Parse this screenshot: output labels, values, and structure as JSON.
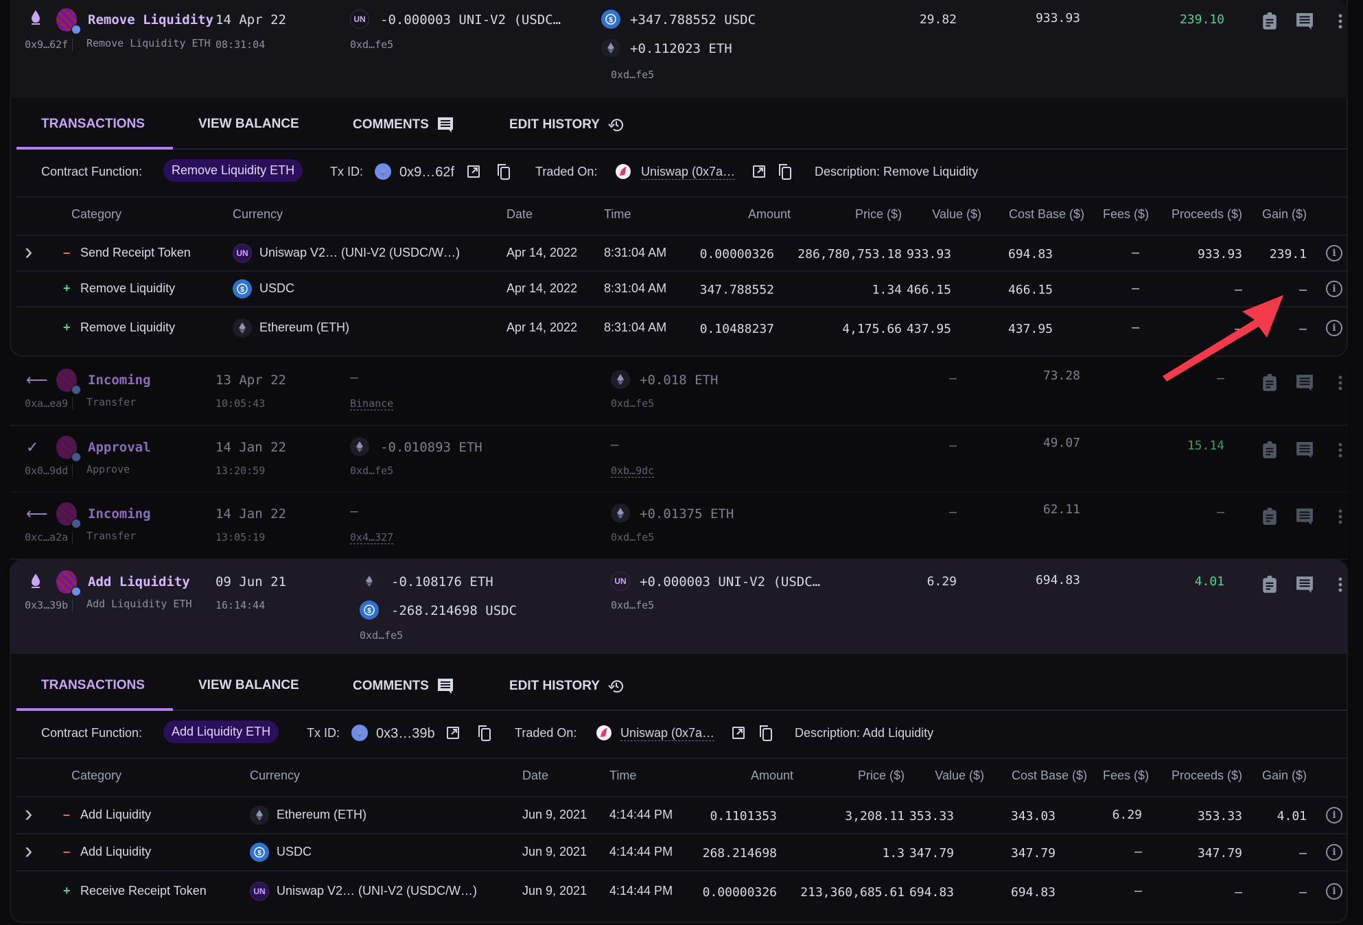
{
  "transactions": [
    {
      "type_icon": "liquidity-remove-icon",
      "title": "Remove Liquidity",
      "tx_hash": "0x9…62f",
      "subtitle": "Remove Liquidity ETH",
      "date": "14 Apr 22",
      "time": "08:31:04",
      "sent": [
        {
          "token": "UN",
          "amount": "-0.000003 UNI-V2 (USDC…"
        }
      ],
      "sent_address": "0xd…fe5",
      "received": [
        {
          "token": "USDC",
          "amount": "+347.788552 USDC"
        },
        {
          "token": "ETH",
          "amount": "+0.112023 ETH"
        }
      ],
      "received_address": "0xd…fe5",
      "fee": "29.82",
      "value": "933.93",
      "gain": "239.10"
    },
    {
      "type_icon": "arrow-left-icon",
      "title": "Incoming",
      "tx_hash": "0xa…ea9",
      "subtitle": "Transfer",
      "date": "13 Apr 22",
      "time": "10:05:43",
      "sent_text": "–",
      "sent_address": "Binance",
      "received": [
        {
          "token": "ETH",
          "amount": "+0.018 ETH"
        }
      ],
      "received_address": "0xd…fe5",
      "fee": "–",
      "value": "73.28",
      "gain": "–"
    },
    {
      "type_icon": "check-icon",
      "title": "Approval",
      "tx_hash": "0x0…9dd",
      "subtitle": "Approve",
      "date": "14 Jan 22",
      "time": "13:20:59",
      "sent": [
        {
          "token": "ETH",
          "amount": "-0.010893 ETH"
        }
      ],
      "sent_address": "0xd…fe5",
      "received_text": "–",
      "received_address": "0xb…9dc",
      "fee": "–",
      "value": "49.07",
      "gain": "15.14"
    },
    {
      "type_icon": "arrow-left-icon",
      "title": "Incoming",
      "tx_hash": "0xc…a2a",
      "subtitle": "Transfer",
      "date": "14 Jan 22",
      "time": "13:05:19",
      "sent_text": "–",
      "sent_address": "0x4…327",
      "received": [
        {
          "token": "ETH",
          "amount": "+0.01375 ETH"
        }
      ],
      "received_address": "0xd…fe5",
      "fee": "–",
      "value": "62.11",
      "gain": "–"
    },
    {
      "type_icon": "liquidity-add-icon",
      "title": "Add Liquidity",
      "tx_hash": "0x3…39b",
      "subtitle": "Add Liquidity ETH",
      "date": "09 Jun 21",
      "time": "16:14:44",
      "sent": [
        {
          "token": "ETH",
          "amount": "-0.108176 ETH"
        },
        {
          "token": "USDC",
          "amount": "-268.214698 USDC"
        }
      ],
      "sent_address": "0xd…fe5",
      "received": [
        {
          "token": "UN",
          "amount": "+0.000003 UNI-V2 (USDC…"
        }
      ],
      "received_address": "0xd…fe5",
      "fee": "6.29",
      "value": "694.83",
      "gain": "4.01"
    }
  ],
  "tabs": {
    "transactions": "TRANSACTIONS",
    "view_balance": "VIEW BALANCE",
    "comments": "COMMENTS",
    "edit_history": "EDIT HISTORY"
  },
  "details_labels": {
    "contract_function": "Contract Function:",
    "tx_id": "Tx ID:",
    "traded_on": "Traded On:"
  },
  "details": [
    {
      "contract_function": "Remove Liquidity ETH",
      "tx_id": "0x9…62f",
      "traded_on": "Uniswap (0x7a…",
      "description": "Description: Remove Liquidity"
    },
    {
      "contract_function": "Add Liquidity ETH",
      "tx_id": "0x3…39b",
      "traded_on": "Uniswap (0x7a…",
      "description": "Description: Add Liquidity"
    }
  ],
  "table_headers": [
    "Category",
    "Currency",
    "Date",
    "Time",
    "Amount",
    "Price ($)",
    "Value ($)",
    "Cost Base ($)",
    "Fees ($)",
    "Proceeds ($)",
    "Gain ($)"
  ],
  "detail_tables": [
    [
      {
        "sign": "–",
        "category": "Send Receipt Token",
        "token": "UN",
        "currency": "Uniswap V2… (UNI-V2 (USDC/W…)",
        "date": "Apr 14, 2022",
        "time": "8:31:04 AM",
        "amount": "0.00000326",
        "price": "286,780,753.18",
        "value": "933.93",
        "cost_base": "694.83",
        "fees": "–",
        "proceeds": "933.93",
        "gain": "239.1",
        "expandable": true
      },
      {
        "sign": "+",
        "category": "Remove Liquidity",
        "token": "USDC",
        "currency": "USDC",
        "date": "Apr 14, 2022",
        "time": "8:31:04 AM",
        "amount": "347.788552",
        "price": "1.34",
        "value": "466.15",
        "cost_base": "466.15",
        "fees": "–",
        "proceeds": "–",
        "gain": "–",
        "expandable": false
      },
      {
        "sign": "+",
        "category": "Remove Liquidity",
        "token": "ETH",
        "currency": "Ethereum (ETH)",
        "date": "Apr 14, 2022",
        "time": "8:31:04 AM",
        "amount": "0.10488237",
        "price": "4,175.66",
        "value": "437.95",
        "cost_base": "437.95",
        "fees": "–",
        "proceeds": "–",
        "gain": "–",
        "expandable": false
      }
    ],
    [
      {
        "sign": "–",
        "category": "Add Liquidity",
        "token": "ETH",
        "currency": "Ethereum (ETH)",
        "date": "Jun 9, 2021",
        "time": "4:14:44 PM",
        "amount": "0.1101353",
        "price": "3,208.11",
        "value": "353.33",
        "cost_base": "343.03",
        "fees": "6.29",
        "proceeds": "353.33",
        "gain": "4.01",
        "expandable": true
      },
      {
        "sign": "–",
        "category": "Add Liquidity",
        "token": "USDC",
        "currency": "USDC",
        "date": "Jun 9, 2021",
        "time": "4:14:44 PM",
        "amount": "268.214698",
        "price": "1.3",
        "value": "347.79",
        "cost_base": "347.79",
        "fees": "–",
        "proceeds": "347.79",
        "gain": "–",
        "expandable": true
      },
      {
        "sign": "+",
        "category": "Receive Receipt Token",
        "token": "UN",
        "currency": "Uniswap V2… (UNI-V2 (USDC/W…)",
        "date": "Jun 9, 2021",
        "time": "4:14:44 PM",
        "amount": "0.00000326",
        "price": "213,360,685.61",
        "value": "694.83",
        "cost_base": "694.83",
        "fees": "–",
        "proceeds": "–",
        "gain": "–",
        "expandable": false
      }
    ]
  ],
  "token_labels": {
    "UN": "UN"
  },
  "colors": {
    "accent": "#b57ef0",
    "gain": "#4fd494",
    "loss": "#f27272",
    "annotation_arrow": "#f23a4a"
  }
}
